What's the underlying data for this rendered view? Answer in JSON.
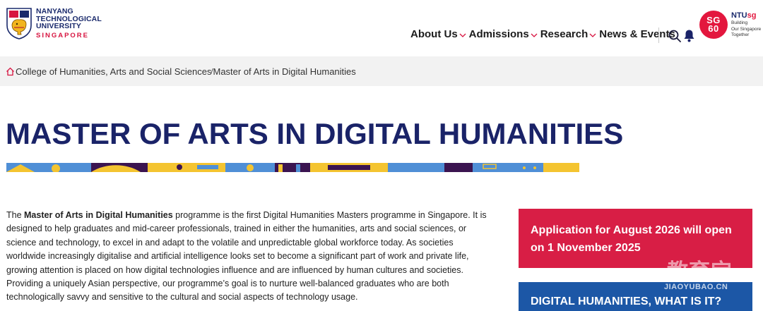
{
  "header": {
    "logo": {
      "line1": "NANYANG",
      "line2": "TECHNOLOGICAL",
      "line3": "UNIVERSITY",
      "line4": "SINGAPORE"
    },
    "nav": [
      {
        "label": "About Us",
        "has_dropdown": true
      },
      {
        "label": "Admissions",
        "has_dropdown": true
      },
      {
        "label": "Research",
        "has_dropdown": true
      },
      {
        "label": "News & Events",
        "has_dropdown": false
      }
    ],
    "icons": {
      "search": "search-icon",
      "notifications": "bell-icon"
    },
    "sg60": {
      "line1": "SG",
      "line2": "60"
    },
    "ntusg": {
      "title_prefix": "NTU",
      "title_suffix": "sg",
      "tag1": "Building",
      "tag2": "Our Singapore",
      "tag3": "Together"
    }
  },
  "breadcrumb": {
    "items": [
      "College of Humanities, Arts and Social Sciences",
      "Master of Arts in Digital Humanities"
    ]
  },
  "page": {
    "title": "MASTER OF ARTS IN DIGITAL HUMANITIES",
    "intro": {
      "pre": "The ",
      "bold": "Master of Arts in Digital Humanities",
      "post": " programme is the first Digital Humanities Masters programme in Singapore. It is designed to help graduates and mid-career professionals, trained in either the humanities, arts and social sciences, or science and technology, to excel in and adapt to the volatile and unpredictable global workforce today. As societies worldwide increasingly digitalise and artificial intelligence looks set to become a significant part of work and private life, growing attention is placed on how digital technologies influence and are influenced by human cultures and societies. Providing a uniquely Asian perspective, our programme’s goal is to nurture well-balanced graduates who are both technologically savvy and sensitive to the cultural and social aspects of technology usage."
    }
  },
  "sidebar": {
    "application_notice": "Application for August 2026 will open on 1 November 2025",
    "what_is_it": "DIGITAL HUMANITIES, WHAT IS IT?"
  },
  "watermark": {
    "cn": "教育宝",
    "en": "JIAOYUBAO.CN"
  },
  "colors": {
    "brand_navy": "#1a2368",
    "brand_red": "#d81e45",
    "brand_blue": "#1c57a6",
    "breadcrumb_bg": "#f2f2f2",
    "banner_purple": "#3b1450",
    "banner_yellow": "#f4c430",
    "banner_blue": "#4f8fd6"
  }
}
